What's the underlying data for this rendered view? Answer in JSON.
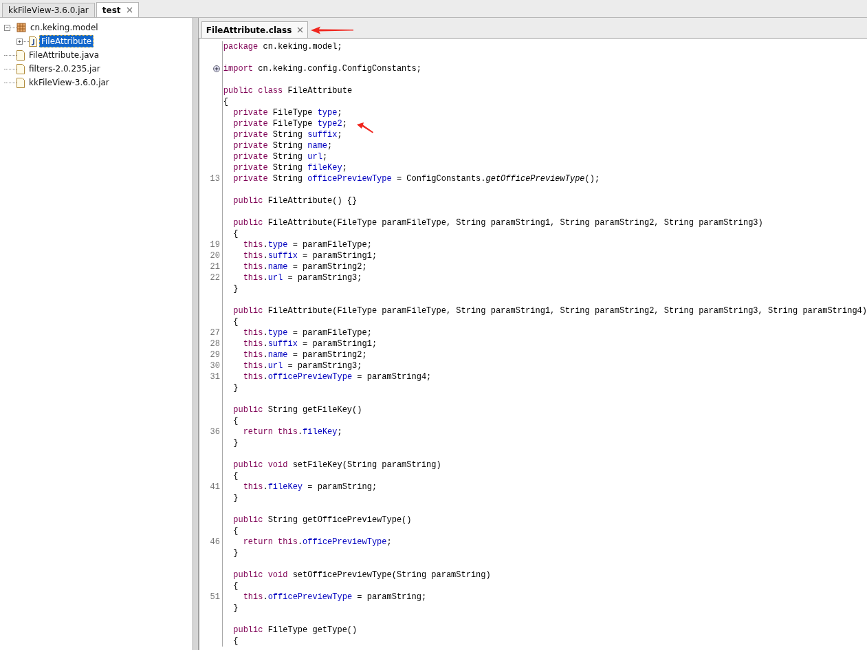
{
  "top_tabs": [
    {
      "label": "kkFileView-3.6.0.jar",
      "selected": false,
      "closable": false
    },
    {
      "label": "test",
      "selected": true,
      "closable": true
    }
  ],
  "tree": [
    {
      "label": "cn.keking.model",
      "kind": "package",
      "expanded": true,
      "selected": false,
      "children": [
        {
          "label": "FileAttribute",
          "kind": "class",
          "expanded": false,
          "selected": true
        }
      ]
    },
    {
      "label": "FileAttribute.java",
      "kind": "file",
      "selected": false
    },
    {
      "label": "filters-2.0.235.jar",
      "kind": "file",
      "selected": false
    },
    {
      "label": "kkFileView-3.6.0.jar",
      "kind": "file",
      "selected": false
    }
  ],
  "editor_tabs": [
    {
      "label": "FileAttribute.class",
      "selected": true,
      "closable": true
    }
  ],
  "code_lines": [
    {
      "kind": "code",
      "tokens": [
        {
          "kind": "kw",
          "text": "package"
        },
        {
          "kind": "plain",
          "text": " cn.keking.model;"
        }
      ]
    },
    {
      "kind": "blank"
    },
    {
      "kind": "folded",
      "tokens": [
        {
          "kind": "kw",
          "text": "import"
        },
        {
          "kind": "plain",
          "text": " cn.keking.config.ConfigConstants;"
        }
      ]
    },
    {
      "kind": "blank"
    },
    {
      "kind": "code",
      "tokens": [
        {
          "kind": "kw",
          "text": "public class"
        },
        {
          "kind": "plain",
          "text": " FileAttribute"
        }
      ]
    },
    {
      "kind": "code",
      "tokens": [
        {
          "kind": "plain",
          "text": "{"
        }
      ]
    },
    {
      "kind": "code",
      "tokens": [
        {
          "kind": "kw",
          "text": "  private"
        },
        {
          "kind": "plain",
          "text": " FileType "
        },
        {
          "kind": "field",
          "text": "type"
        },
        {
          "kind": "plain",
          "text": ";"
        }
      ]
    },
    {
      "kind": "code",
      "tokens": [
        {
          "kind": "kw",
          "text": "  private"
        },
        {
          "kind": "plain",
          "text": " FileType "
        },
        {
          "kind": "field",
          "text": "type2"
        },
        {
          "kind": "plain",
          "text": ";"
        }
      ]
    },
    {
      "kind": "code",
      "tokens": [
        {
          "kind": "kw",
          "text": "  private"
        },
        {
          "kind": "plain",
          "text": " String "
        },
        {
          "kind": "field",
          "text": "suffix"
        },
        {
          "kind": "plain",
          "text": ";"
        }
      ]
    },
    {
      "kind": "code",
      "tokens": [
        {
          "kind": "kw",
          "text": "  private"
        },
        {
          "kind": "plain",
          "text": " String "
        },
        {
          "kind": "field",
          "text": "name"
        },
        {
          "kind": "plain",
          "text": ";"
        }
      ]
    },
    {
      "kind": "code",
      "tokens": [
        {
          "kind": "kw",
          "text": "  private"
        },
        {
          "kind": "plain",
          "text": " String "
        },
        {
          "kind": "field",
          "text": "url"
        },
        {
          "kind": "plain",
          "text": ";"
        }
      ]
    },
    {
      "kind": "code",
      "tokens": [
        {
          "kind": "kw",
          "text": "  private"
        },
        {
          "kind": "plain",
          "text": " String "
        },
        {
          "kind": "field",
          "text": "fileKey"
        },
        {
          "kind": "plain",
          "text": ";"
        }
      ]
    },
    {
      "kind": "code",
      "number": "13",
      "tokens": [
        {
          "kind": "kw",
          "text": "  private"
        },
        {
          "kind": "plain",
          "text": " String "
        },
        {
          "kind": "field",
          "text": "officePreviewType"
        },
        {
          "kind": "plain",
          "text": " = ConfigConstants."
        },
        {
          "kind": "call",
          "text": "getOfficePreviewType"
        },
        {
          "kind": "plain",
          "text": "();"
        }
      ]
    },
    {
      "kind": "blank"
    },
    {
      "kind": "code",
      "tokens": [
        {
          "kind": "kw",
          "text": "  public"
        },
        {
          "kind": "plain",
          "text": " FileAttribute() {}"
        }
      ]
    },
    {
      "kind": "blank"
    },
    {
      "kind": "code",
      "tokens": [
        {
          "kind": "kw",
          "text": "  public"
        },
        {
          "kind": "plain",
          "text": " FileAttribute(FileType paramFileType, String paramString1, String paramString2, String paramString3)"
        }
      ]
    },
    {
      "kind": "code",
      "tokens": [
        {
          "kind": "plain",
          "text": "  {"
        }
      ]
    },
    {
      "kind": "code",
      "number": "19",
      "tokens": [
        {
          "kind": "kw",
          "text": "    this"
        },
        {
          "kind": "plain",
          "text": "."
        },
        {
          "kind": "field",
          "text": "type"
        },
        {
          "kind": "plain",
          "text": " = paramFileType;"
        }
      ]
    },
    {
      "kind": "code",
      "number": "20",
      "tokens": [
        {
          "kind": "kw",
          "text": "    this"
        },
        {
          "kind": "plain",
          "text": "."
        },
        {
          "kind": "field",
          "text": "suffix"
        },
        {
          "kind": "plain",
          "text": " = paramString1;"
        }
      ]
    },
    {
      "kind": "code",
      "number": "21",
      "tokens": [
        {
          "kind": "kw",
          "text": "    this"
        },
        {
          "kind": "plain",
          "text": "."
        },
        {
          "kind": "field",
          "text": "name"
        },
        {
          "kind": "plain",
          "text": " = paramString2;"
        }
      ]
    },
    {
      "kind": "code",
      "number": "22",
      "tokens": [
        {
          "kind": "kw",
          "text": "    this"
        },
        {
          "kind": "plain",
          "text": "."
        },
        {
          "kind": "field",
          "text": "url"
        },
        {
          "kind": "plain",
          "text": " = paramString3;"
        }
      ]
    },
    {
      "kind": "code",
      "tokens": [
        {
          "kind": "plain",
          "text": "  }"
        }
      ]
    },
    {
      "kind": "blank"
    },
    {
      "kind": "code",
      "tokens": [
        {
          "kind": "kw",
          "text": "  public"
        },
        {
          "kind": "plain",
          "text": " FileAttribute(FileType paramFileType, String paramString1, String paramString2, String paramString3, String paramString4)"
        }
      ]
    },
    {
      "kind": "code",
      "tokens": [
        {
          "kind": "plain",
          "text": "  {"
        }
      ]
    },
    {
      "kind": "code",
      "number": "27",
      "tokens": [
        {
          "kind": "kw",
          "text": "    this"
        },
        {
          "kind": "plain",
          "text": "."
        },
        {
          "kind": "field",
          "text": "type"
        },
        {
          "kind": "plain",
          "text": " = paramFileType;"
        }
      ]
    },
    {
      "kind": "code",
      "number": "28",
      "tokens": [
        {
          "kind": "kw",
          "text": "    this"
        },
        {
          "kind": "plain",
          "text": "."
        },
        {
          "kind": "field",
          "text": "suffix"
        },
        {
          "kind": "plain",
          "text": " = paramString1;"
        }
      ]
    },
    {
      "kind": "code",
      "number": "29",
      "tokens": [
        {
          "kind": "kw",
          "text": "    this"
        },
        {
          "kind": "plain",
          "text": "."
        },
        {
          "kind": "field",
          "text": "name"
        },
        {
          "kind": "plain",
          "text": " = paramString2;"
        }
      ]
    },
    {
      "kind": "code",
      "number": "30",
      "tokens": [
        {
          "kind": "kw",
          "text": "    this"
        },
        {
          "kind": "plain",
          "text": "."
        },
        {
          "kind": "field",
          "text": "url"
        },
        {
          "kind": "plain",
          "text": " = paramString3;"
        }
      ]
    },
    {
      "kind": "code",
      "number": "31",
      "tokens": [
        {
          "kind": "kw",
          "text": "    this"
        },
        {
          "kind": "plain",
          "text": "."
        },
        {
          "kind": "field",
          "text": "officePreviewType"
        },
        {
          "kind": "plain",
          "text": " = paramString4;"
        }
      ]
    },
    {
      "kind": "code",
      "tokens": [
        {
          "kind": "plain",
          "text": "  }"
        }
      ]
    },
    {
      "kind": "blank"
    },
    {
      "kind": "code",
      "tokens": [
        {
          "kind": "kw",
          "text": "  public"
        },
        {
          "kind": "plain",
          "text": " String getFileKey()"
        }
      ]
    },
    {
      "kind": "code",
      "tokens": [
        {
          "kind": "plain",
          "text": "  {"
        }
      ]
    },
    {
      "kind": "code",
      "number": "36",
      "tokens": [
        {
          "kind": "kw",
          "text": "    return this"
        },
        {
          "kind": "plain",
          "text": "."
        },
        {
          "kind": "field",
          "text": "fileKey"
        },
        {
          "kind": "plain",
          "text": ";"
        }
      ]
    },
    {
      "kind": "code",
      "tokens": [
        {
          "kind": "plain",
          "text": "  }"
        }
      ]
    },
    {
      "kind": "blank"
    },
    {
      "kind": "code",
      "tokens": [
        {
          "kind": "kw",
          "text": "  public void"
        },
        {
          "kind": "plain",
          "text": " setFileKey(String paramString)"
        }
      ]
    },
    {
      "kind": "code",
      "tokens": [
        {
          "kind": "plain",
          "text": "  {"
        }
      ]
    },
    {
      "kind": "code",
      "number": "41",
      "tokens": [
        {
          "kind": "kw",
          "text": "    this"
        },
        {
          "kind": "plain",
          "text": "."
        },
        {
          "kind": "field",
          "text": "fileKey"
        },
        {
          "kind": "plain",
          "text": " = paramString;"
        }
      ]
    },
    {
      "kind": "code",
      "tokens": [
        {
          "kind": "plain",
          "text": "  }"
        }
      ]
    },
    {
      "kind": "blank"
    },
    {
      "kind": "code",
      "tokens": [
        {
          "kind": "kw",
          "text": "  public"
        },
        {
          "kind": "plain",
          "text": " String getOfficePreviewType()"
        }
      ]
    },
    {
      "kind": "code",
      "tokens": [
        {
          "kind": "plain",
          "text": "  {"
        }
      ]
    },
    {
      "kind": "code",
      "number": "46",
      "tokens": [
        {
          "kind": "kw",
          "text": "    return this"
        },
        {
          "kind": "plain",
          "text": "."
        },
        {
          "kind": "field",
          "text": "officePreviewType"
        },
        {
          "kind": "plain",
          "text": ";"
        }
      ]
    },
    {
      "kind": "code",
      "tokens": [
        {
          "kind": "plain",
          "text": "  }"
        }
      ]
    },
    {
      "kind": "blank"
    },
    {
      "kind": "code",
      "tokens": [
        {
          "kind": "kw",
          "text": "  public void"
        },
        {
          "kind": "plain",
          "text": " setOfficePreviewType(String paramString)"
        }
      ]
    },
    {
      "kind": "code",
      "tokens": [
        {
          "kind": "plain",
          "text": "  {"
        }
      ]
    },
    {
      "kind": "code",
      "number": "51",
      "tokens": [
        {
          "kind": "kw",
          "text": "    this"
        },
        {
          "kind": "plain",
          "text": "."
        },
        {
          "kind": "field",
          "text": "officePreviewType"
        },
        {
          "kind": "plain",
          "text": " = paramString;"
        }
      ]
    },
    {
      "kind": "code",
      "tokens": [
        {
          "kind": "plain",
          "text": "  }"
        }
      ]
    },
    {
      "kind": "blank"
    },
    {
      "kind": "code",
      "tokens": [
        {
          "kind": "kw",
          "text": "  public"
        },
        {
          "kind": "plain",
          "text": " FileType getType()"
        }
      ]
    },
    {
      "kind": "code",
      "tokens": [
        {
          "kind": "plain",
          "text": "  {"
        }
      ]
    }
  ]
}
